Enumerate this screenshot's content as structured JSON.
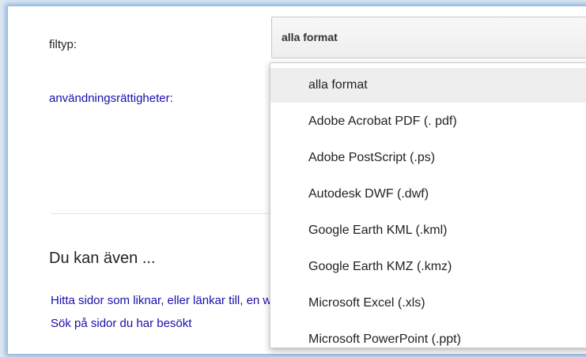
{
  "form": {
    "filetype_label": "filtyp:",
    "rights_label": "användningsrättigheter:"
  },
  "filetype_select": {
    "value": "alla format",
    "options": [
      "alla format",
      "Adobe Acrobat PDF (. pdf)",
      "Adobe PostScript (.ps)",
      "Autodesk DWF (.dwf)",
      "Google Earth KML (.kml)",
      "Google Earth KMZ (.kmz)",
      "Microsoft Excel (.xls)",
      "Microsoft PowerPoint (.ppt)"
    ],
    "selected_index": 0
  },
  "also": {
    "heading": "Du kan även ...",
    "links": [
      "Hitta sidor som liknar, eller länkar till, en webbadress",
      "Sök på sidor du har besökt"
    ]
  },
  "colors": {
    "link": "#1a0dab",
    "window_glow": "#4882c8"
  }
}
